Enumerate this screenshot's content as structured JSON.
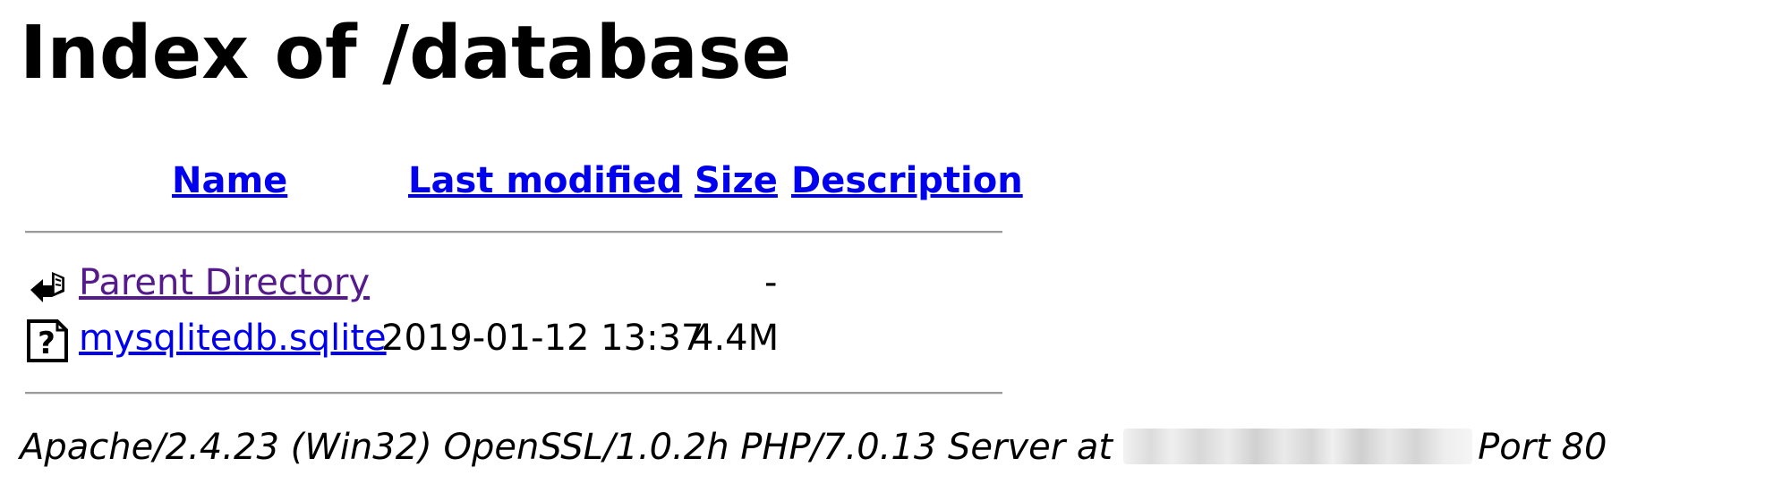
{
  "page": {
    "title": "Index of /database"
  },
  "columns": {
    "name": "Name",
    "last_modified": "Last modified",
    "size": "Size",
    "description": "Description"
  },
  "rows": [
    {
      "icon": "back-arrow-icon",
      "name": "Parent Directory",
      "last_modified": "",
      "size": "-",
      "description": ""
    },
    {
      "icon": "unknown-file-icon",
      "name": "mysqlitedb.sqlite",
      "last_modified": "2019-01-12 13:37",
      "size": "4.4M",
      "description": ""
    }
  ],
  "footer": {
    "server_prefix": "Apache/2.4.23 (Win32) OpenSSL/1.0.2h PHP/7.0.13 Server at",
    "server_suffix": "Port 80"
  },
  "colors": {
    "link": "#0000ee",
    "visited_link": "#551a8b",
    "rule": "#9a9a9a"
  }
}
